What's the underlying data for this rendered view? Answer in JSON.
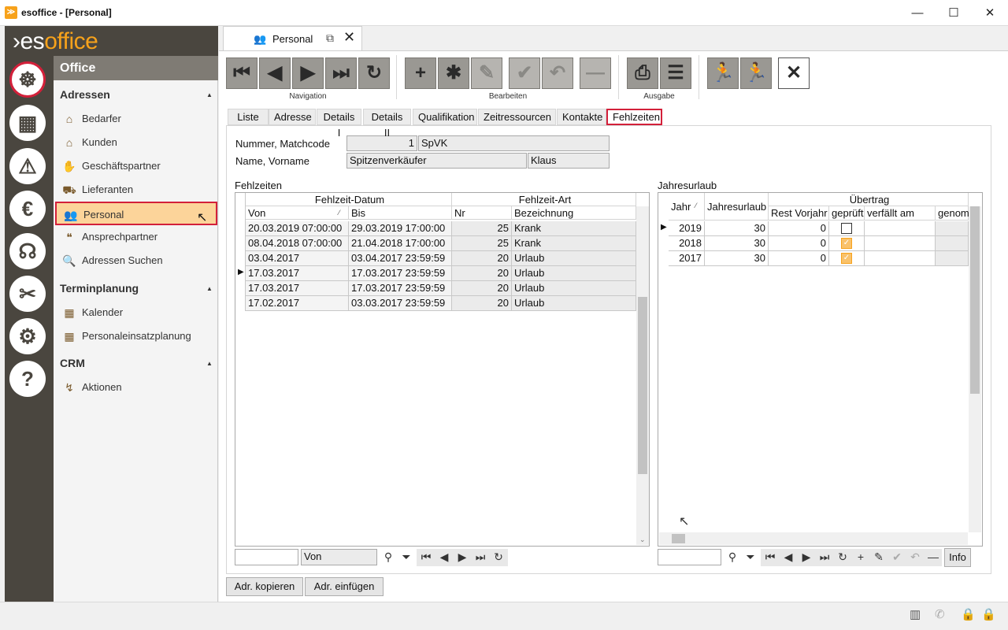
{
  "window": {
    "title": "esoffice - [Personal]",
    "minimize": "—",
    "maximize": "☐",
    "close": "✕"
  },
  "brand": {
    "logo_prefix": "es",
    "logo_main": "office"
  },
  "rail": [
    {
      "name": "settings-wheel-icon",
      "glyph": "☸",
      "active": true
    },
    {
      "name": "planner-icon",
      "glyph": "▦"
    },
    {
      "name": "alarm-icon",
      "glyph": "⚠"
    },
    {
      "name": "euro-icon",
      "glyph": "€"
    },
    {
      "name": "headset-icon",
      "glyph": "☊"
    },
    {
      "name": "tools-icon",
      "glyph": "✂"
    },
    {
      "name": "gears-icon",
      "glyph": "⚙"
    },
    {
      "name": "help-icon",
      "glyph": "?"
    }
  ],
  "nav": {
    "title": "Office",
    "groups": [
      {
        "label": "Adressen",
        "items": [
          "Bedarfer",
          "Kunden",
          "Geschäftspartner",
          "Lieferanten",
          "Personal",
          "Ansprechpartner",
          "Adressen Suchen"
        ]
      },
      {
        "label": "Terminplanung",
        "items": [
          "Kalender",
          "Personaleinsatzplanung"
        ]
      },
      {
        "label": "CRM",
        "items": [
          "Aktionen"
        ]
      }
    ],
    "item_icons": [
      "⌂",
      "⌂",
      "✋",
      "⛟",
      "👥",
      "❝",
      "🔍",
      "▦",
      "▦",
      "↯"
    ]
  },
  "doc_tab": {
    "label": "Personal"
  },
  "toolbar": {
    "navigation_label": "Navigation",
    "edit_label": "Bearbeiten",
    "output_label": "Ausgabe"
  },
  "tabs": [
    "Liste",
    "Adresse",
    "Details I",
    "Details II",
    "Qualifikation",
    "Zeitressourcen",
    "Kontakte",
    "Fehlzeiten"
  ],
  "form": {
    "nummer_label": "Nummer, Matchcode",
    "nummer": "1",
    "matchcode": "SpVK",
    "name_label": "Name, Vorname",
    "name": "Spitzenverkäufer",
    "vorname": "Klaus"
  },
  "fehlzeiten": {
    "section_label": "Fehlzeiten",
    "group1": "Fehlzeit-Datum",
    "group2": "Fehlzeit-Art",
    "columns": [
      "Von",
      "Bis",
      "Nr",
      "Bezeichnung"
    ],
    "rows": [
      [
        "20.03.2019 07:00:00",
        "29.03.2019 17:00:00",
        "25",
        "Krank"
      ],
      [
        "08.04.2018 07:00:00",
        "21.04.2018 17:00:00",
        "25",
        "Krank"
      ],
      [
        "03.04.2017",
        "03.04.2017 23:59:59",
        "20",
        "Urlaub"
      ],
      [
        "17.03.2017",
        "17.03.2017 23:59:59",
        "20",
        "Urlaub"
      ],
      [
        "17.03.2017",
        "17.03.2017 23:59:59",
        "20",
        "Urlaub"
      ],
      [
        "17.02.2017",
        "03.03.2017 23:59:59",
        "20",
        "Urlaub"
      ]
    ],
    "current_row": 3,
    "filter_field": "Von"
  },
  "jahresurlaub": {
    "section_label": "Jahresurlaub",
    "group_label": "Übertrag",
    "columns": [
      "Jahr",
      "Jahresurlaub",
      "Rest Vorjahr",
      "geprüft",
      "verfällt am",
      "genom"
    ],
    "rows": [
      {
        "jahr": "2019",
        "urlaub": "30",
        "rest": "0",
        "geprueft": false
      },
      {
        "jahr": "2018",
        "urlaub": "30",
        "rest": "0",
        "geprueft": true
      },
      {
        "jahr": "2017",
        "urlaub": "30",
        "rest": "0",
        "geprueft": true
      }
    ],
    "info_label": "Info"
  },
  "buttons": {
    "copy": "Adr. kopieren",
    "paste": "Adr. einfügen"
  },
  "accent": "#f7a21b",
  "highlight": "#d3203a"
}
